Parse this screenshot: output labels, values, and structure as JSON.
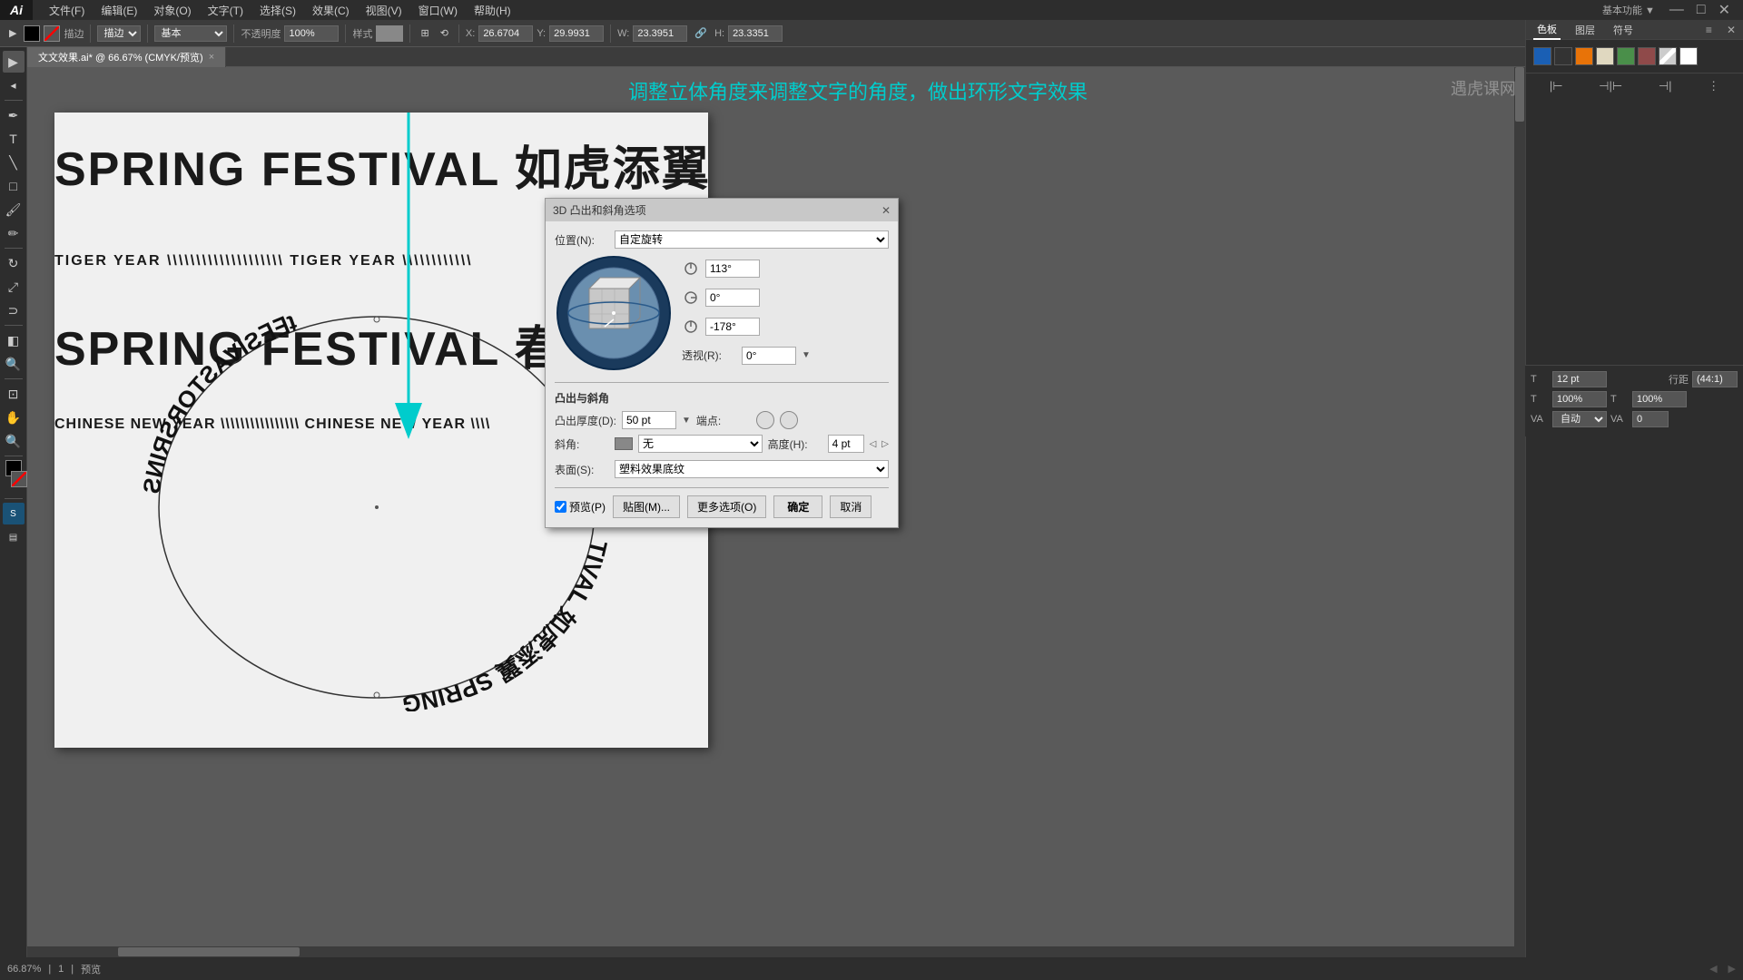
{
  "app": {
    "name": "Ai",
    "title": "Adobe Illustrator"
  },
  "menu": {
    "items": [
      "文件(F)",
      "编辑(E)",
      "对象(O)",
      "文字(T)",
      "选择(S)",
      "效果(C)",
      "视图(V)",
      "窗口(W)",
      "帮助(H)"
    ]
  },
  "toolbar": {
    "stroke_label": "描边",
    "basic_label": "基本",
    "opacity_label": "不透明度",
    "opacity_value": "100%",
    "style_label": "样式",
    "x_label": "X:",
    "x_value": "26.6704",
    "y_label": "Y:",
    "y_value": "29.9931",
    "w_label": "W:",
    "w_value": "23.3951",
    "h_label": "H:",
    "h_value": "23.3351"
  },
  "tab": {
    "label": "文文效果.ai* @ 66.67% (CMYK/预览)",
    "close_label": "×"
  },
  "right_panel": {
    "tabs": [
      "色板",
      "图层",
      "符号"
    ]
  },
  "instruction": "调整立体角度来调整文字的角度，做出环形文字效果",
  "canvas": {
    "text1": "SPRING FESTIVAL 如虎添翼 SPRING FESTIVA",
    "text2": "TIGER YEAR \\\\\\\\\\\\\\\\\\\\\\\\\\\\\\\\\\\\\\\\ TIGER YEAR \\\\\\\\\\\\\\\\\\\\\\\\",
    "text3": "SPRING FESTIVAL 春节是中华民族最隆重的传统佳节 SPRING FESTIVAL",
    "text4": "CHINESE NEW YEAR \\\\\\\\\\\\\\\\\\\\\\\\\\\\\\\\ CHINESE NEW YEAR \\\\\\\\",
    "circle_text_top": "ƧИIЯƧЯОТƧAVITƧ∃∃ʇ",
    "circle_text_bottom": "TIVAL 如虎添翼 SPR"
  },
  "dialog": {
    "title": "3D 凸出和斜角选项",
    "position_label": "位置(N):",
    "position_value": "自定旋转",
    "angle1_label": "角度1",
    "angle1_value": "113°",
    "angle2_label": "角度2",
    "angle2_value": "0°",
    "angle3_label": "角度3",
    "angle3_value": "-178°",
    "perspective_label": "透视(R):",
    "perspective_value": "0°",
    "extrude_title": "凸出与斜角",
    "extrude_depth_label": "凸出厚度(D):",
    "extrude_depth_value": "50 pt",
    "cap_label": "端点:",
    "bevel_label": "斜角:",
    "bevel_value": "无",
    "bevel_height_label": "高度(H):",
    "bevel_height_value": "4 pt",
    "surface_label": "表面(S):",
    "surface_value": "塑料效果底纹",
    "preview_label": "预览(P)",
    "map_label": "贴图(M)...",
    "more_label": "更多选项(O)",
    "ok_label": "确定",
    "cancel_label": "取消"
  },
  "typo_panel": {
    "font_size_label": "T",
    "font_size_value": "12 pt",
    "scale_x_label": "T",
    "scale_x_value": "100%",
    "scale_y_value": "100%",
    "tracking_label": "VA",
    "tracking_value": "自动",
    "kerning_value": "0"
  },
  "status": {
    "zoom": "66.87%",
    "artboard": "1",
    "view": "预览"
  },
  "watermark": "遇虎课网"
}
